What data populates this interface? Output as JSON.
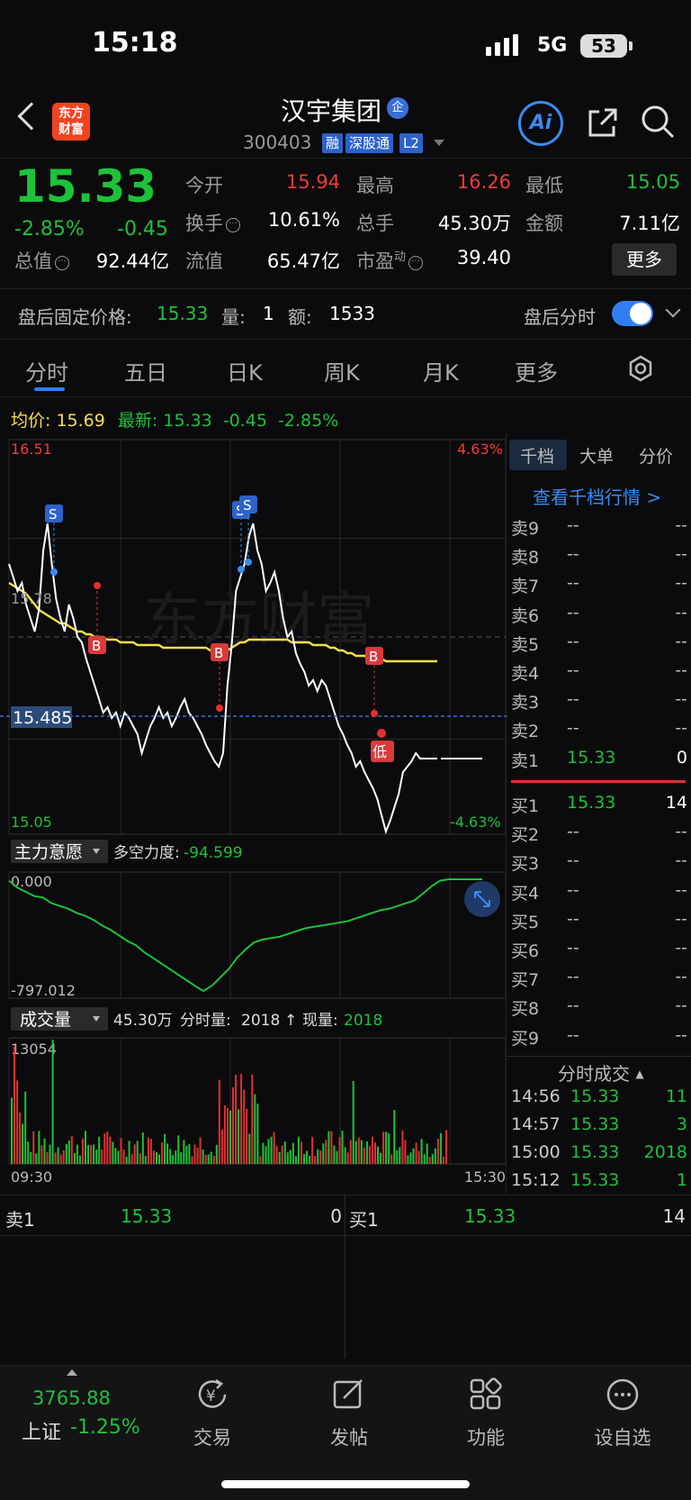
{
  "status": {
    "time": "15:18",
    "network": "5G",
    "battery": "53"
  },
  "header": {
    "logo_line1": "东方",
    "logo_line2": "财富",
    "stock_name": "汉宇集团",
    "qi_badge": "企",
    "stock_code": "300403",
    "tags": [
      "融",
      "深股通",
      "L2"
    ],
    "ai_label": "Ai"
  },
  "quote": {
    "price": "15.33",
    "change_pct": "-2.85%",
    "change_abs": "-0.45",
    "open_label": "今开",
    "open": "15.94",
    "high_label": "最高",
    "high": "16.26",
    "low_label": "最低",
    "low": "15.05",
    "turnover_label": "换手",
    "turnover": "10.61%",
    "volume_label": "总手",
    "volume": "45.30万",
    "amount_label": "金额",
    "amount": "7.11亿",
    "mktcap_label": "总值",
    "mktcap": "92.44亿",
    "float_label": "流值",
    "float": "65.47亿",
    "pe_label": "市盈",
    "pe_sup": "动",
    "pe": "39.40",
    "more_label": "更多"
  },
  "after_hours": {
    "price_label": "盘后固定价格:",
    "price": "15.33",
    "qty_label": "量:",
    "qty": "1",
    "amt_label": "额:",
    "amt": "1533",
    "toggle_label": "盘后分时",
    "toggle_on": true
  },
  "tabs": [
    "分时",
    "五日",
    "日K",
    "周K",
    "月K",
    "更多"
  ],
  "chart_header": {
    "avg_label": "均价:",
    "avg": "15.69",
    "latest_label": "最新:",
    "latest": "15.33",
    "latest_chg": "-0.45",
    "latest_pct": "-2.85%"
  },
  "chart_data": {
    "type": "line",
    "y_top": "16.51",
    "y_bottom": "15.05",
    "y_mid": "15.78",
    "pct_top": "4.63%",
    "pct_bottom": "-4.63%",
    "crosshair_value": "15.485",
    "ylim": [
      15.05,
      16.51
    ],
    "x_start": "09:30",
    "x_end": "15:30",
    "series": [
      {
        "values": [
          16.05,
          16.0,
          15.95,
          15.98,
          15.9,
          15.85,
          15.8,
          15.88,
          16.1,
          16.2,
          16.05,
          15.92,
          15.85,
          15.8,
          15.9,
          15.85,
          15.78,
          15.76,
          15.7,
          15.65,
          15.6,
          15.55,
          15.5,
          15.52,
          15.48,
          15.5,
          15.45,
          15.5,
          15.48,
          15.45,
          15.42,
          15.35,
          15.4,
          15.45,
          15.48,
          15.52,
          15.48,
          15.5,
          15.45,
          15.48,
          15.52,
          15.55,
          15.5,
          15.48,
          15.45,
          15.42,
          15.38,
          15.35,
          15.32,
          15.3,
          15.35,
          15.6,
          15.75,
          15.95,
          16.0,
          16.05,
          16.15,
          16.2,
          16.1,
          16.05,
          15.95,
          15.98,
          16.02,
          15.95,
          15.85,
          15.78,
          15.8,
          15.72,
          15.68,
          15.65,
          15.6,
          15.62,
          15.58,
          15.62,
          15.6,
          15.55,
          15.5,
          15.45,
          15.42,
          15.38,
          15.35,
          15.3,
          15.32,
          15.28,
          15.25,
          15.22,
          15.18,
          15.12,
          15.06,
          15.1,
          15.15,
          15.2,
          15.28,
          15.3,
          15.32,
          15.35,
          15.33,
          15.33,
          15.33,
          15.33,
          15.33
        ]
      },
      {
        "values": [
          15.98,
          15.97,
          15.96,
          15.95,
          15.94,
          15.92,
          15.9,
          15.88,
          15.87,
          15.86,
          15.85,
          15.84,
          15.83,
          15.83,
          15.82,
          15.81,
          15.8,
          15.8,
          15.79,
          15.79,
          15.78,
          15.78,
          15.78,
          15.77,
          15.77,
          15.77,
          15.76,
          15.76,
          15.76,
          15.76,
          15.75,
          15.75,
          15.75,
          15.75,
          15.75,
          15.75,
          15.74,
          15.74,
          15.74,
          15.74,
          15.74,
          15.74,
          15.74,
          15.74,
          15.74,
          15.74,
          15.74,
          15.73,
          15.73,
          15.73,
          15.73,
          15.73,
          15.74,
          15.75,
          15.76,
          15.76,
          15.77,
          15.77,
          15.77,
          15.77,
          15.77,
          15.77,
          15.77,
          15.77,
          15.77,
          15.77,
          15.76,
          15.76,
          15.76,
          15.76,
          15.76,
          15.75,
          15.75,
          15.75,
          15.75,
          15.74,
          15.74,
          15.73,
          15.73,
          15.72,
          15.72,
          15.71,
          15.71,
          15.71,
          15.7,
          15.7,
          15.7,
          15.7,
          15.69,
          15.69,
          15.69,
          15.69,
          15.69,
          15.69,
          15.69,
          15.69,
          15.69,
          15.69,
          15.69,
          15.69,
          15.69
        ]
      }
    ],
    "markers": [
      "S",
      "S",
      "S",
      "B",
      "B",
      "B",
      "低"
    ],
    "indicator": {
      "name": "主力意愿",
      "label": "多空力度:",
      "value": "-94.599",
      "top_value": "0.000",
      "bottom_value": "-797.012",
      "ylim": [
        -797.012,
        0
      ],
      "values": [
        -10,
        -60,
        -90,
        -120,
        -130,
        -170,
        -190,
        -210,
        -240,
        -260,
        -290,
        -330,
        -360,
        -400,
        -440,
        -470,
        -520,
        -560,
        -600,
        -640,
        -680,
        -720,
        -760,
        -797,
        -760,
        -700,
        -640,
        -560,
        -500,
        -450,
        -430,
        -420,
        -410,
        -390,
        -370,
        -350,
        -340,
        -330,
        -320,
        -310,
        -300,
        -280,
        -260,
        -240,
        -220,
        -210,
        -190,
        -170,
        -150,
        -100,
        -50,
        -10,
        0,
        0,
        0,
        0,
        0
      ]
    },
    "volume": {
      "name": "成交量",
      "total": "45.30万",
      "label1": "分时量:",
      "value1": "2018",
      "arrow": "↑",
      "label2": "现量:",
      "value2": "2018",
      "max_label": "13054",
      "ylim": [
        0,
        13054
      ]
    }
  },
  "order_book": {
    "tabs": [
      "千档",
      "大单",
      "分价"
    ],
    "link": "查看千档行情 >",
    "asks": [
      {
        "label": "卖9",
        "price": "--",
        "vol": "--"
      },
      {
        "label": "卖8",
        "price": "--",
        "vol": "--"
      },
      {
        "label": "卖7",
        "price": "--",
        "vol": "--"
      },
      {
        "label": "卖6",
        "price": "--",
        "vol": "--"
      },
      {
        "label": "卖5",
        "price": "--",
        "vol": "--"
      },
      {
        "label": "卖4",
        "price": "--",
        "vol": "--"
      },
      {
        "label": "卖3",
        "price": "--",
        "vol": "--"
      },
      {
        "label": "卖2",
        "price": "--",
        "vol": "--"
      },
      {
        "label": "卖1",
        "price": "15.33",
        "vol": "0"
      }
    ],
    "bids": [
      {
        "label": "买1",
        "price": "15.33",
        "vol": "14"
      },
      {
        "label": "买2",
        "price": "--",
        "vol": "--"
      },
      {
        "label": "买3",
        "price": "--",
        "vol": "--"
      },
      {
        "label": "买4",
        "price": "--",
        "vol": "--"
      },
      {
        "label": "买5",
        "price": "--",
        "vol": "--"
      },
      {
        "label": "买6",
        "price": "--",
        "vol": "--"
      },
      {
        "label": "买7",
        "price": "--",
        "vol": "--"
      },
      {
        "label": "买8",
        "price": "--",
        "vol": "--"
      },
      {
        "label": "买9",
        "price": "--",
        "vol": "--"
      }
    ],
    "trades_title": "分时成交",
    "trades": [
      {
        "time": "14:56",
        "price": "15.33",
        "vol": "11"
      },
      {
        "time": "14:57",
        "price": "15.33",
        "vol": "3"
      },
      {
        "time": "15:00",
        "price": "15.33",
        "vol": "2018"
      },
      {
        "time": "15:12",
        "price": "15.33",
        "vol": "1"
      }
    ]
  },
  "bottom_bidask": {
    "ask_label": "卖1",
    "ask_price": "15.33",
    "ask_vol": "0",
    "bid_label": "买1",
    "bid_price": "15.33",
    "bid_vol": "14"
  },
  "bottom_nav": {
    "index_value": "3765.88",
    "index_name": "上证",
    "index_pct": "-1.25%",
    "items": [
      "交易",
      "发帖",
      "功能",
      "设自选"
    ]
  },
  "watermark": "东方财富"
}
